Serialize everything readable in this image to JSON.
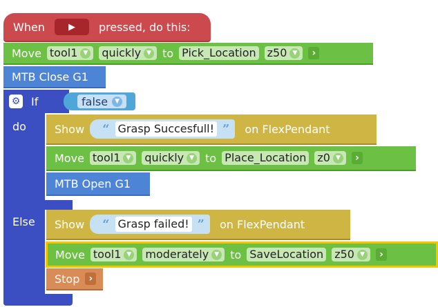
{
  "hat": {
    "when": "When",
    "pressed": "pressed, do this:"
  },
  "move1": {
    "label": "Move",
    "tool": "tool1",
    "speed": "quickly",
    "to": "to",
    "location": "Pick_Location",
    "zone": "z50",
    "expand": "›"
  },
  "mtb_close": "MTB Close G1",
  "if_block": {
    "if": "If",
    "do": "do",
    "else": "Else",
    "condition": "false"
  },
  "show1": {
    "label": "Show",
    "text": "Grasp Succesfull!",
    "target": "on FlexPendant"
  },
  "move2": {
    "label": "Move",
    "tool": "tool1",
    "speed": "quickly",
    "to": "to",
    "location": "Place_Location",
    "zone": "z0",
    "expand": "›"
  },
  "mtb_open": "MTB Open G1",
  "show2": {
    "label": "Show",
    "text": "Grasp failed!",
    "target": "on FlexPendant"
  },
  "move3": {
    "label": "Move",
    "tool": "tool1",
    "speed": "moderately",
    "to": "to",
    "location": "SaveLocation",
    "zone": "z50",
    "expand": "›"
  },
  "stop": {
    "label": "Stop",
    "expand": "›"
  },
  "quote_open": "“",
  "quote_close": "”",
  "dropdown_arrow": "▼",
  "play_icon": "▶"
}
